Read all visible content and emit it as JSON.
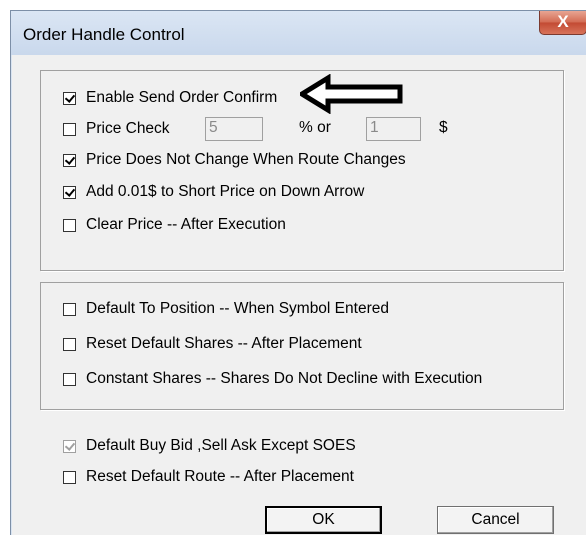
{
  "window": {
    "title": "Order Handle Control",
    "close_label": "X"
  },
  "options": {
    "enable_send_order_confirm": {
      "label": "Enable Send Order Confirm",
      "checked": true
    },
    "price_check": {
      "label": "Price Check",
      "checked": false,
      "percent_value": "5",
      "percent_label": "% or",
      "dollar_value": "1",
      "dollar_label": "$"
    },
    "price_not_change": {
      "label": "Price Does Not Change When Route Changes",
      "checked": true
    },
    "add_001": {
      "label": "Add 0.01$ to Short Price on Down Arrow",
      "checked": true
    },
    "clear_price": {
      "label": "Clear Price -- After Execution",
      "checked": false
    },
    "default_to_position": {
      "label": "Default To Position -- When Symbol Entered",
      "checked": false
    },
    "reset_default_shares": {
      "label": "Reset Default Shares -- After Placement",
      "checked": false
    },
    "constant_shares": {
      "label": "Constant Shares -- Shares Do Not Decline with Execution",
      "checked": false
    },
    "default_buy_bid": {
      "label": "Default Buy Bid ,Sell Ask Except SOES",
      "checked": true,
      "disabled": true
    },
    "reset_default_route": {
      "label": "Reset Default Route -- After Placement",
      "checked": false
    }
  },
  "buttons": {
    "ok": "OK",
    "cancel": "Cancel"
  },
  "annotation": {
    "arrow_color": "#000000"
  }
}
